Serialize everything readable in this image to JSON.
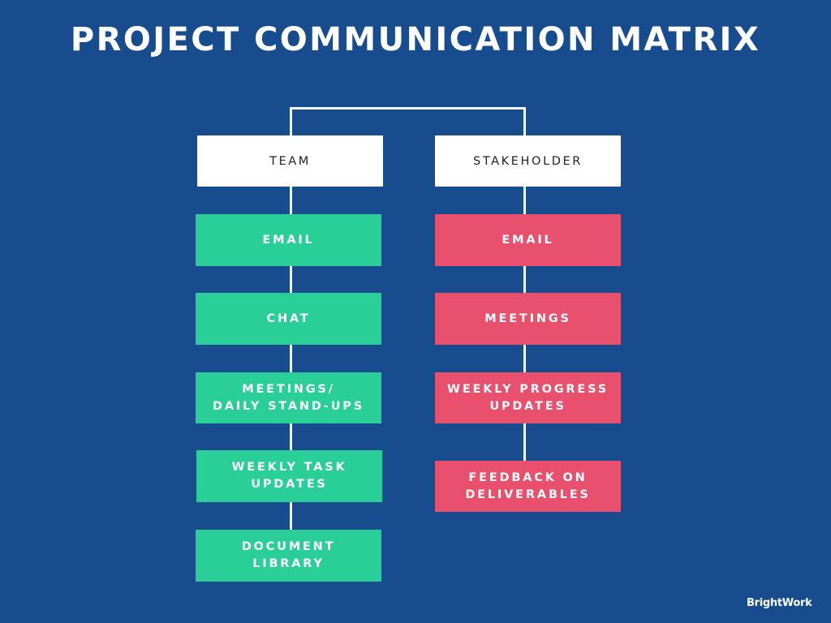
{
  "title": "PROJECT COMMUNICATION MATRIX",
  "colors": {
    "background": "#174D8F",
    "team": "#2ACE97",
    "stakeholder": "#E8506D",
    "header": "#FFFFFF"
  },
  "columns": {
    "team": {
      "header": "TEAM",
      "items": [
        {
          "line1": "EMAIL",
          "line2": ""
        },
        {
          "line1": "CHAT",
          "line2": ""
        },
        {
          "line1": "MEETINGS/",
          "line2": "DAILY STAND-UPS"
        },
        {
          "line1": "WEEKLY TASK",
          "line2": "UPDATES"
        },
        {
          "line1": "DOCUMENT",
          "line2": "LIBRARY"
        }
      ]
    },
    "stakeholder": {
      "header": "STAKEHOLDER",
      "items": [
        {
          "line1": "EMAIL",
          "line2": ""
        },
        {
          "line1": "MEETINGS",
          "line2": ""
        },
        {
          "line1": "WEEKLY PROGRESS",
          "line2": "UPDATES"
        },
        {
          "line1": "FEEDBACK ON",
          "line2": "DELIVERABLES"
        }
      ]
    }
  },
  "brand": "BrightWork"
}
